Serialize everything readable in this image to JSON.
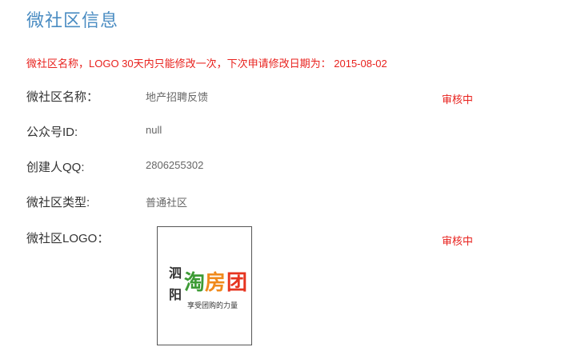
{
  "page": {
    "title": "微社区信息",
    "notice": "微社区名称，LOGO 30天内只能修改一次，下次申请修改日期为： 2015-08-02"
  },
  "fields": {
    "name": {
      "label": "微社区名称：",
      "value": "地产招聘反馈",
      "status": "审核中"
    },
    "account_id": {
      "label": "公众号ID:",
      "value": "null"
    },
    "creator_qq": {
      "label": "创建人QQ:",
      "value": "2806255302"
    },
    "type": {
      "label": "微社区类型:",
      "value": "普通社区"
    },
    "logo": {
      "label": "微社区LOGO：",
      "status": "审核中",
      "image_text": {
        "left": "泗阳",
        "main": "淘房团",
        "tagline": "享受团购的力量"
      },
      "colors": {
        "green": "#3d9b35",
        "orange": "#f08a1c",
        "red": "#e6341f",
        "dark": "#333333"
      }
    }
  }
}
